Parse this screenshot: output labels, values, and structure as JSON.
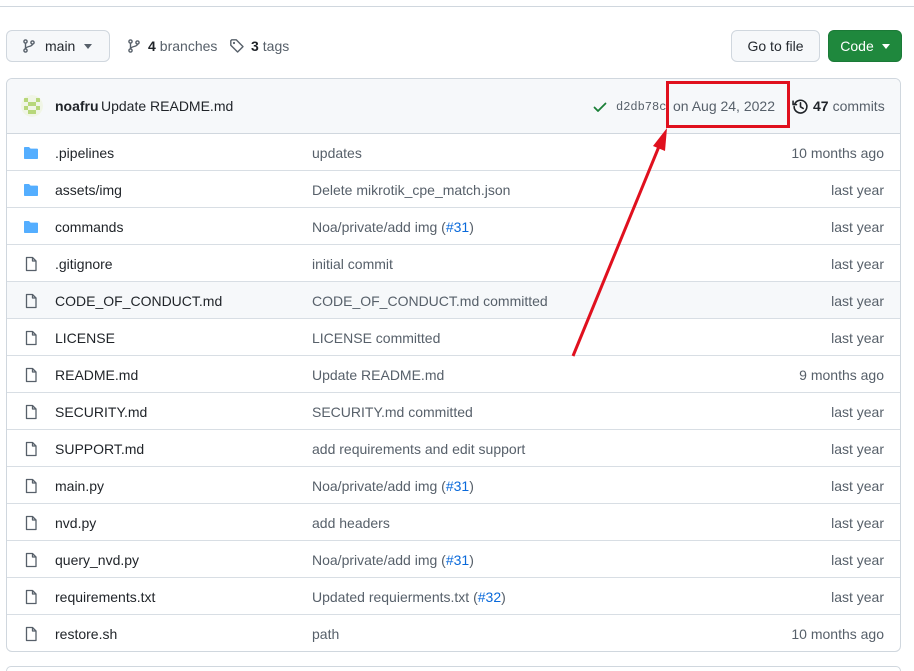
{
  "toolbar": {
    "branch": "main",
    "branches_count": "4",
    "branches_label": "branches",
    "tags_count": "3",
    "tags_label": "tags",
    "go_to_file": "Go to file",
    "code": "Code"
  },
  "latest_commit": {
    "author": "noafru",
    "message": "Update README.md",
    "sha": "d2db78c",
    "date": "on Aug 24, 2022",
    "commits_count": "47",
    "commits_label": "commits",
    "status": "success"
  },
  "files": [
    {
      "type": "folder",
      "name": ".pipelines",
      "message": "updates",
      "pr": "",
      "message_suffix": "",
      "date": "10 months ago"
    },
    {
      "type": "folder",
      "name": "assets/img",
      "message": "Delete mikrotik_cpe_match.json",
      "pr": "",
      "message_suffix": "",
      "date": "last year"
    },
    {
      "type": "folder",
      "name": "commands",
      "message": "Noa/private/add img (",
      "pr": "#31",
      "message_suffix": ")",
      "date": "last year"
    },
    {
      "type": "file",
      "name": ".gitignore",
      "message": "initial commit",
      "pr": "",
      "message_suffix": "",
      "date": "last year"
    },
    {
      "type": "file",
      "name": "CODE_OF_CONDUCT.md",
      "message": "CODE_OF_CONDUCT.md committed",
      "pr": "",
      "message_suffix": "",
      "date": "last year"
    },
    {
      "type": "file",
      "name": "LICENSE",
      "message": "LICENSE committed",
      "pr": "",
      "message_suffix": "",
      "date": "last year"
    },
    {
      "type": "file",
      "name": "README.md",
      "message": "Update README.md",
      "pr": "",
      "message_suffix": "",
      "date": "9 months ago"
    },
    {
      "type": "file",
      "name": "SECURITY.md",
      "message": "SECURITY.md committed",
      "pr": "",
      "message_suffix": "",
      "date": "last year"
    },
    {
      "type": "file",
      "name": "SUPPORT.md",
      "message": "add requirements and edit support",
      "pr": "",
      "message_suffix": "",
      "date": "last year"
    },
    {
      "type": "file",
      "name": "main.py",
      "message": "Noa/private/add img (",
      "pr": "#31",
      "message_suffix": ")",
      "date": "last year"
    },
    {
      "type": "file",
      "name": "nvd.py",
      "message": "add headers",
      "pr": "",
      "message_suffix": "",
      "date": "last year"
    },
    {
      "type": "file",
      "name": "query_nvd.py",
      "message": "Noa/private/add img (",
      "pr": "#31",
      "message_suffix": ")",
      "date": "last year"
    },
    {
      "type": "file",
      "name": "requirements.txt",
      "message": "Updated requierments.txt (",
      "pr": "#32",
      "message_suffix": ")",
      "date": "last year"
    },
    {
      "type": "file",
      "name": "restore.sh",
      "message": "path",
      "pr": "",
      "message_suffix": "",
      "date": "10 months ago"
    }
  ],
  "hovered_row": "CODE_OF_CONDUCT.md",
  "colors": {
    "accent_green": "#1f883d",
    "folder_blue": "#54aeff",
    "link_blue": "#0969da",
    "annotation_red": "#e0101e"
  },
  "icons": {
    "branch": "git-branch-icon",
    "tag": "tag-icon",
    "check": "check-icon",
    "history": "history-icon",
    "folder": "folder-icon",
    "file": "file-icon"
  }
}
